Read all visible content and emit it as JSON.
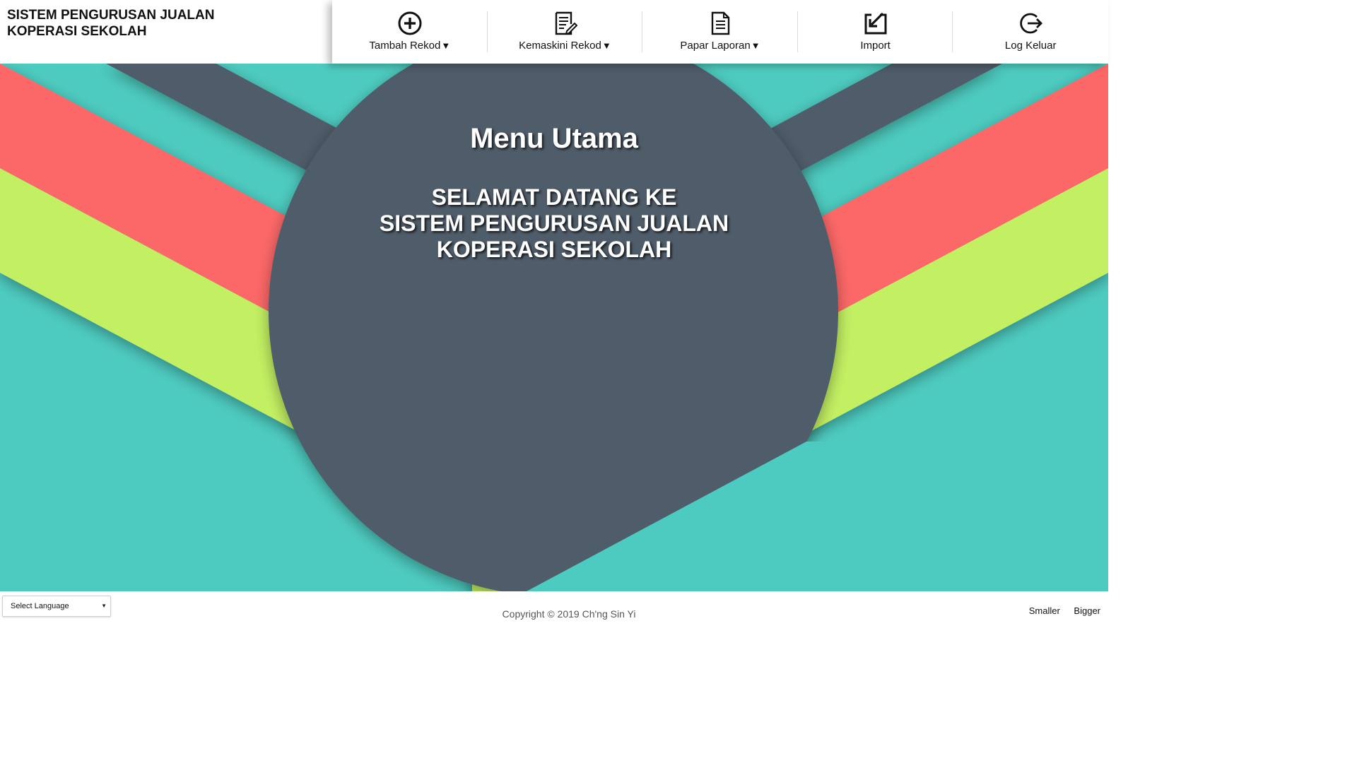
{
  "brand": {
    "line1": "SISTEM PENGURUSAN JUALAN",
    "line2": "KOPERASI SEKOLAH"
  },
  "nav": {
    "items": [
      {
        "label": "Tambah Rekod",
        "caret": "▼",
        "icon": "plus-circle-icon"
      },
      {
        "label": "Kemaskini Rekod",
        "caret": "▼",
        "icon": "edit-document-icon"
      },
      {
        "label": "Papar Laporan",
        "caret": "▼",
        "icon": "document-icon"
      },
      {
        "label": "Import",
        "caret": "",
        "icon": "import-icon"
      },
      {
        "label": "Log Keluar",
        "caret": "",
        "icon": "logout-icon"
      }
    ]
  },
  "hero": {
    "title": "Menu Utama",
    "welcome_line1": "SELAMAT DATANG KE",
    "welcome_line2": "SISTEM PENGURUSAN JUALAN",
    "welcome_line3": "KOPERASI SEKOLAH"
  },
  "footer": {
    "language_select": "Select Language",
    "copyright": "Copyright © 2019 Ch'ng Sin Yi",
    "smaller": "Smaller",
    "bigger": "Bigger"
  },
  "colors": {
    "teal": "#4ecbc0",
    "slate": "#4f5b69",
    "coral": "#fc6868",
    "lime": "#c3f063"
  }
}
